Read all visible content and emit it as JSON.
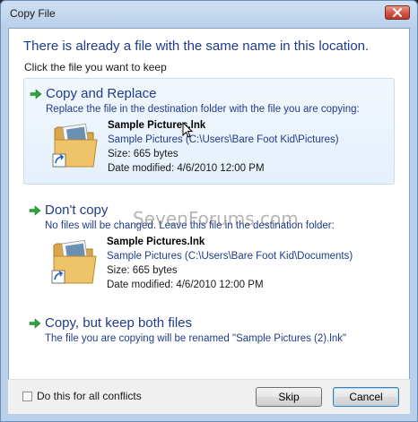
{
  "window": {
    "title": "Copy File"
  },
  "content": {
    "heading": "There is already a file with the same name in this location.",
    "subheading": "Click the file you want to keep"
  },
  "options": [
    {
      "title": "Copy and Replace",
      "description": "Replace the file in the destination folder with the file you are copying:",
      "file": {
        "name": "Sample Pictures.lnk",
        "path": "Sample Pictures (C:\\Users\\Bare Foot Kid\\Pictures)",
        "size": "Size: 665 bytes",
        "modified": "Date modified: 4/6/2010 12:00 PM"
      }
    },
    {
      "title": "Don't copy",
      "description": "No files will be changed. Leave this file in the destination folder:",
      "file": {
        "name": "Sample Pictures.lnk",
        "path": "Sample Pictures (C:\\Users\\Bare Foot Kid\\Documents)",
        "size": "Size: 665 bytes",
        "modified": "Date modified: 4/6/2010 12:00 PM"
      }
    },
    {
      "title": "Copy, but keep both files",
      "description": "The file you are copying will be renamed \"Sample Pictures (2).lnk\""
    }
  ],
  "footer": {
    "checkbox_label": "Do this for all conflicts",
    "checkbox_checked": false,
    "skip_label": "Skip",
    "cancel_label": "Cancel"
  },
  "watermark": "SevenForums.com",
  "colors": {
    "link_blue": "#1e3c8c",
    "arrow_green": "#2ea43a",
    "close_red": "#c8473a"
  },
  "icons": {
    "close": "close-icon",
    "arrow": "green-arrow-icon",
    "folder": "folder-shortcut-icon"
  }
}
